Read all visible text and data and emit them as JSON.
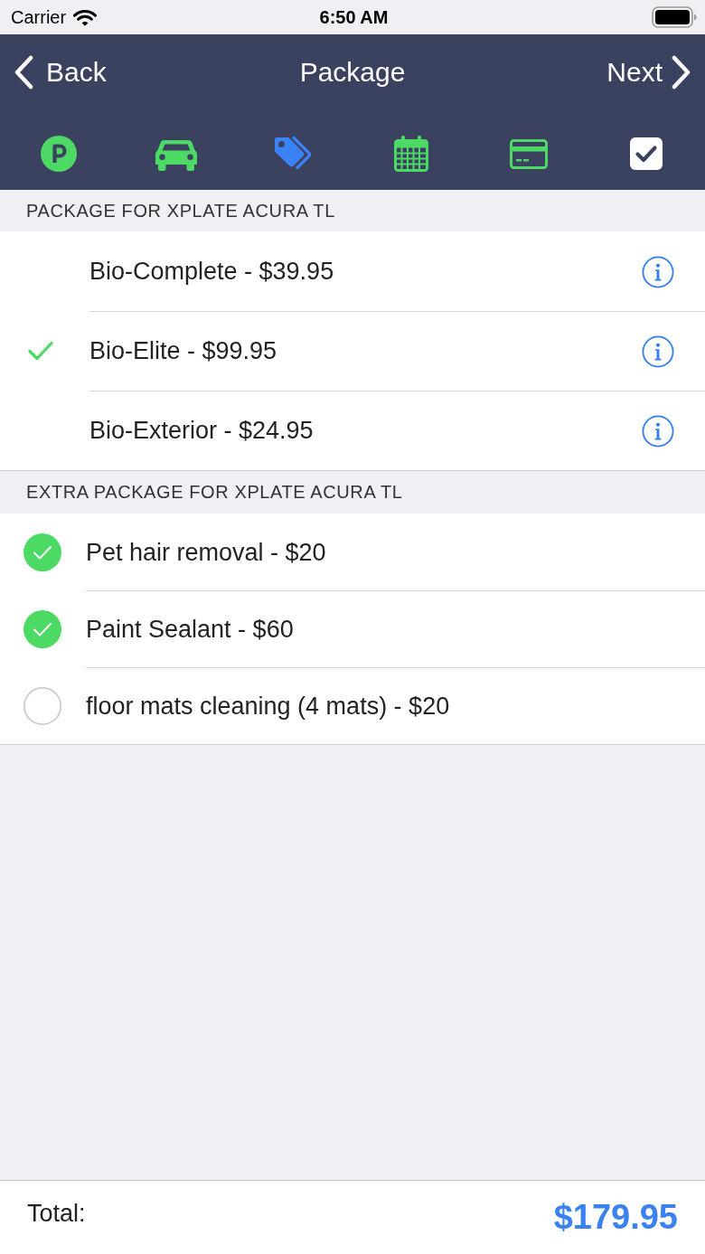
{
  "status_bar": {
    "carrier": "Carrier",
    "time": "6:50 AM"
  },
  "nav_bar": {
    "back": "Back",
    "title": "Package",
    "next": "Next"
  },
  "steps": [
    {
      "kind": "parking",
      "selected": false
    },
    {
      "kind": "car",
      "selected": false
    },
    {
      "kind": "tag",
      "selected": true
    },
    {
      "kind": "calendar",
      "selected": false
    },
    {
      "kind": "card",
      "selected": false
    },
    {
      "kind": "confirm",
      "selected": false
    }
  ],
  "packages": {
    "header": "PACKAGE FOR XPLATE ACURA TL",
    "items": [
      {
        "label": "Bio-Complete - $39.95",
        "selected": false
      },
      {
        "label": "Bio-Elite - $99.95",
        "selected": true
      },
      {
        "label": "Bio-Exterior - $24.95",
        "selected": false
      }
    ]
  },
  "extras": {
    "header": "EXTRA PACKAGE FOR XPLATE ACURA TL",
    "items": [
      {
        "label": "Pet hair removal - $20",
        "checked": true
      },
      {
        "label": "Paint Sealant - $60",
        "checked": true
      },
      {
        "label": "floor mats cleaning (4 mats) - $20",
        "checked": false
      }
    ]
  },
  "footer": {
    "label": "Total:",
    "amount": "$179.95"
  }
}
